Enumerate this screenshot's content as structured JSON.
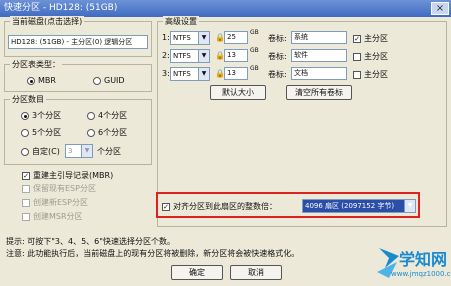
{
  "window": {
    "title": "快速分区 - HD128: (51GB)",
    "close_glyph": "×"
  },
  "disk_group": {
    "title": "当前磁盘(点击选择)",
    "selected_disk": "HD128: (51GB) - 主分区(0) 逻辑分区"
  },
  "table_type": {
    "title": "分区表类型：",
    "options": [
      "MBR",
      "GUID"
    ],
    "selected": "MBR"
  },
  "partition_count": {
    "title": "分区数目",
    "options": [
      "3个分区",
      "4个分区",
      "5个分区",
      "6个分区"
    ],
    "custom_label": "自定(C)",
    "custom_value": "3",
    "custom_unit": "个分区"
  },
  "mbr_options": {
    "rebuild_mbr": "重建主引导记录(MBR)",
    "opt2": "保留现有ESP分区",
    "opt3": "创建新ESP分区",
    "opt4": "创建MSR分区"
  },
  "advanced": {
    "title": "高级设置",
    "rows": [
      {
        "index": "1:",
        "fs": "NTFS",
        "size": "25",
        "unit": "GB",
        "label_caption": "卷标:",
        "label": "系统",
        "primary": "主分区",
        "primary_checked": true
      },
      {
        "index": "2:",
        "fs": "NTFS",
        "size": "13",
        "unit": "GB",
        "label_caption": "卷标:",
        "label": "软件",
        "primary": "主分区",
        "primary_checked": false
      },
      {
        "index": "3:",
        "fs": "NTFS",
        "size": "13",
        "unit": "GB",
        "label_caption": "卷标:",
        "label": "文档",
        "primary": "主分区",
        "primary_checked": false
      }
    ],
    "default_size_button": "默认大小",
    "clear_labels_button": "清空所有卷标"
  },
  "align": {
    "checkbox_label": "对齐分区到此扇区的整数倍：",
    "value": "4096 扇区 (2097152 字节)"
  },
  "tips": {
    "line1": "提示: 可按下\"3、4、5、6\"快速选择分区个数。",
    "line2": "注意: 此功能执行后，当前磁盘上的现有分区将被删除，新分区将会被快速格式化。"
  },
  "buttons": {
    "ok": "确定",
    "cancel": "取消"
  },
  "watermark": {
    "name": "学知网",
    "url": "www.jmqz1000.com"
  },
  "colors": {
    "title_bar": "#3f6bc2",
    "highlight": "#dd2222",
    "dialog_bg": "#ece9d8",
    "watermark_fg": "#1a8ad0"
  }
}
